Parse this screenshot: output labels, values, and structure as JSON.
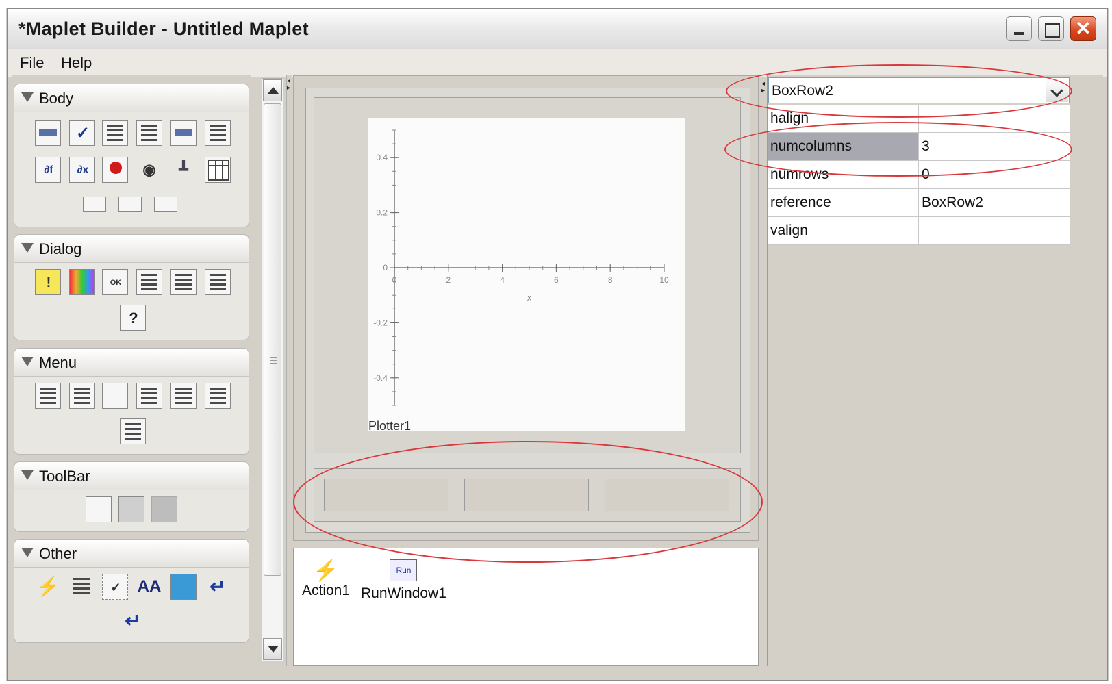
{
  "window": {
    "title": "*Maplet Builder - Untitled Maplet"
  },
  "menu": {
    "file": "File",
    "help": "Help"
  },
  "palette": {
    "groups": [
      {
        "label": "Body"
      },
      {
        "label": "Dialog"
      },
      {
        "label": "Menu"
      },
      {
        "label": "ToolBar"
      },
      {
        "label": "Other"
      }
    ]
  },
  "canvas": {
    "plot": {
      "chart_data": {
        "type": "line",
        "xlabel": "x",
        "x_ticks": [
          "0",
          "2",
          "4",
          "6",
          "8",
          "10"
        ],
        "y_ticks": [
          "0.4",
          "0.2",
          "0",
          "-0.2",
          "-0.4"
        ],
        "xlim": [
          0,
          10
        ],
        "ylim": [
          -0.5,
          0.5
        ],
        "series": []
      },
      "caption": "Plotter1"
    },
    "boxrow_cells": 3
  },
  "tray": {
    "items": [
      {
        "label": "Action1",
        "icon": "action-running-man-icon"
      },
      {
        "label": "RunWindow1",
        "icon": "run-window-icon",
        "icon_text": "Run"
      }
    ]
  },
  "properties": {
    "selected": "BoxRow2",
    "rows": [
      {
        "key": "halign",
        "value": ""
      },
      {
        "key": "numcolumns",
        "value": "3"
      },
      {
        "key": "numrows",
        "value": "0"
      },
      {
        "key": "reference",
        "value": "BoxRow2"
      },
      {
        "key": "valign",
        "value": ""
      }
    ]
  },
  "colors": {
    "annotation": "#d9383a",
    "selection": "#a8a8b0"
  }
}
